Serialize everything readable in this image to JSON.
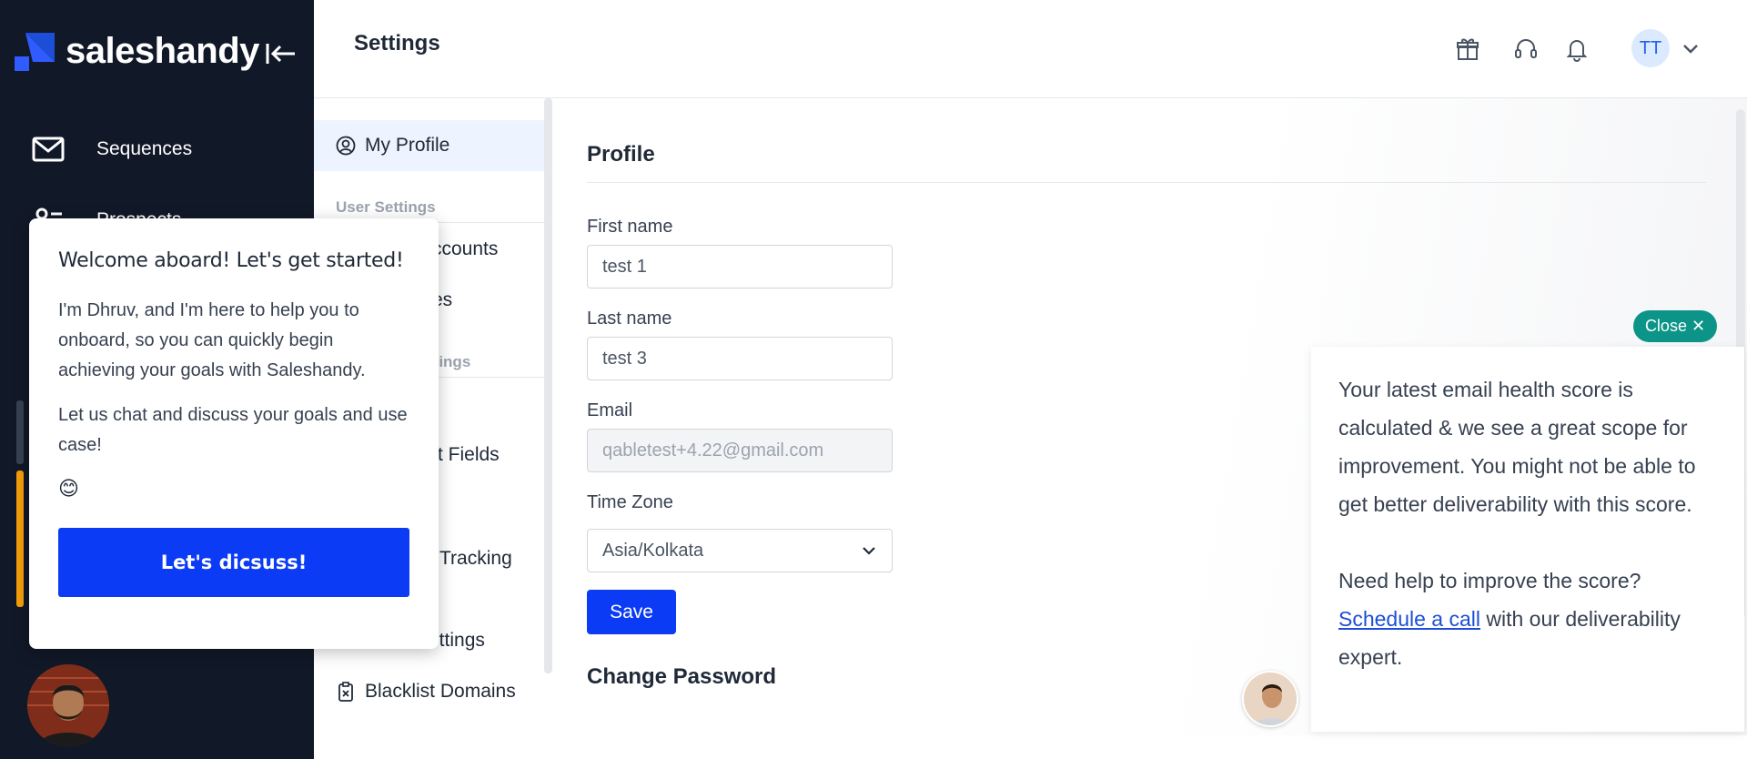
{
  "brand": {
    "name": "saleshandy",
    "accent": "#0b3bf5",
    "sidebar_bg": "#111827"
  },
  "sidebar": {
    "items": [
      {
        "label": "Sequences",
        "icon": "mail-icon"
      },
      {
        "label": "Prospects",
        "icon": "users-icon"
      }
    ]
  },
  "header": {
    "title": "Settings",
    "icons": [
      "gift-icon",
      "headset-icon",
      "bell-icon"
    ],
    "avatar_initials": "TT"
  },
  "settings_menu": {
    "items": [
      {
        "label": "My Profile",
        "active": true
      },
      {
        "group": "User Settings"
      },
      {
        "label": "ccounts"
      },
      {
        "label": "es"
      },
      {
        "group": "ttings"
      },
      {
        "label": "t Fields"
      },
      {
        "label": "Tracking"
      },
      {
        "label": "ettings"
      },
      {
        "label": "Blacklist Domains"
      }
    ]
  },
  "profile": {
    "section_title": "Profile",
    "first_name": {
      "label": "First name",
      "value": "test 1"
    },
    "last_name": {
      "label": "Last name",
      "value": "test 3"
    },
    "email": {
      "label": "Email",
      "value": "qabletest+4.22@gmail.com"
    },
    "time_zone": {
      "label": "Time Zone",
      "value": "Asia/Kolkata"
    },
    "save_label": "Save",
    "change_password_title": "Change Password"
  },
  "welcome_popup": {
    "title": "Welcome aboard! Let's get started!",
    "body1": "I'm Dhruv, and I'm here to help you to onboard, so you can quickly begin achieving your goals with Saleshandy.",
    "body2": "Let us chat and discuss your goals and use case!",
    "emoji": "😊",
    "cta": "Let's dicsuss!"
  },
  "health_popup": {
    "close_label": "Close",
    "message": "Your latest email health score is calculated & we see a great scope for improvement. You might not be able to get better deliverability with this score.",
    "help_text": "Need help to improve the score?",
    "link_text": "Schedule a call",
    "link_suffix": " with our deliverability expert.",
    "close_color": "#0d9488"
  }
}
